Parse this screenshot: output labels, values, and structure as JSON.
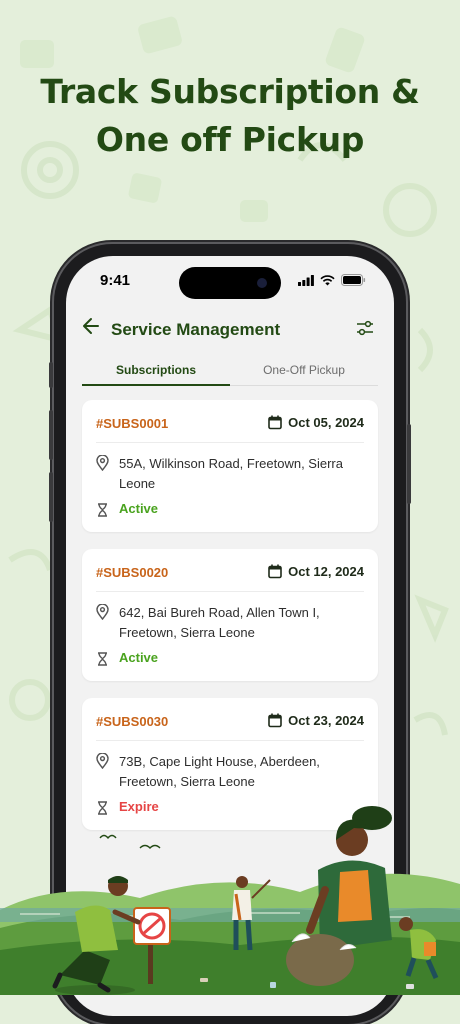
{
  "headline": {
    "line1": "Track Subscription &",
    "line2": "One off Pickup"
  },
  "status_bar": {
    "time": "9:41"
  },
  "app_bar": {
    "title": "Service Management"
  },
  "tabs": [
    {
      "label": "Subscriptions",
      "active": true
    },
    {
      "label": "One-Off Pickup",
      "active": false
    }
  ],
  "cards": [
    {
      "id": "#SUBS0001",
      "date": "Oct 05, 2024",
      "address": "55A, Wilkinson Road, Freetown, Sierra Leone",
      "status": "Active"
    },
    {
      "id": "#SUBS0020",
      "date": "Oct 12, 2024",
      "address": "642,  Bai Bureh Road, Allen Town I, Freetown, Sierra Leone",
      "status": "Active"
    },
    {
      "id": "#SUBS0030",
      "date": "Oct 23, 2024",
      "address": "73B, Cape Light House, Aberdeen, Freetown, Sierra Leone",
      "status": "Expire"
    }
  ],
  "colors": {
    "brand_green": "#234a14",
    "id_orange": "#c8641a",
    "status_active": "#4aa31f",
    "status_expire": "#e64545",
    "background": "#e4efdb"
  },
  "icons": [
    "back-arrow-icon",
    "filter-icon",
    "calendar-icon",
    "location-pin-icon",
    "hourglass-icon",
    "signal-icon",
    "wifi-icon",
    "battery-icon",
    "no-littering-sign-icon"
  ]
}
